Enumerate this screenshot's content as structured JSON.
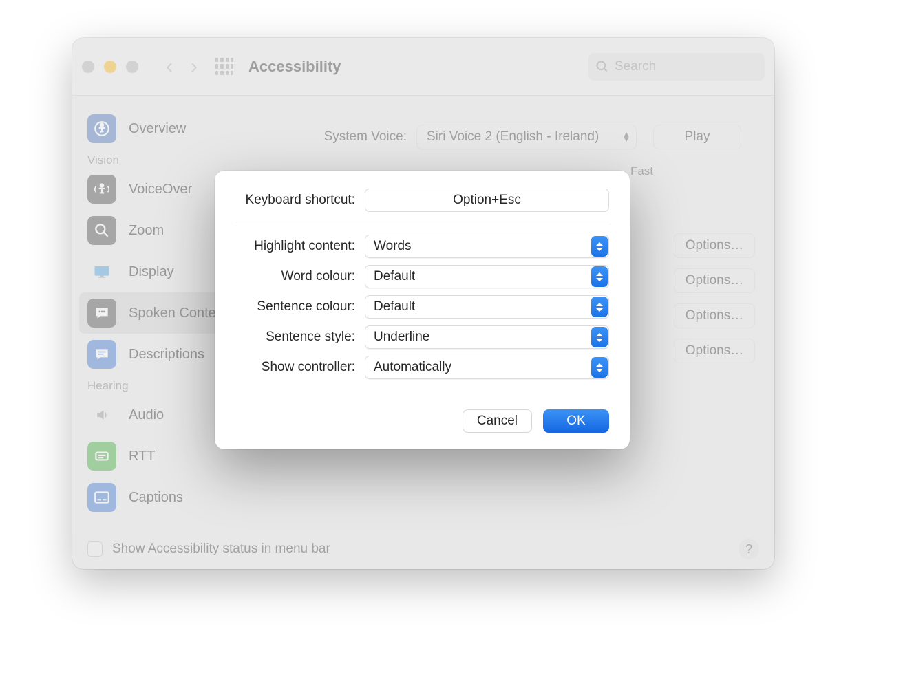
{
  "window": {
    "title": "Accessibility",
    "search_placeholder": "Search"
  },
  "sidebar": {
    "sections": {
      "vision_label": "Vision",
      "hearing_label": "Hearing"
    },
    "items": {
      "overview": "Overview",
      "voiceover": "VoiceOver",
      "zoom": "Zoom",
      "display": "Display",
      "spoken": "Spoken Content",
      "descriptions": "Descriptions",
      "audio": "Audio",
      "rtt": "RTT",
      "captions": "Captions"
    }
  },
  "main": {
    "system_voice_label": "System Voice:",
    "system_voice_value": "Siri Voice 2 (English - Ireland)",
    "play_button": "Play",
    "speed_fast": "Fast",
    "options_button": "Options…"
  },
  "footer": {
    "status_label": "Show Accessibility status in menu bar",
    "help": "?"
  },
  "sheet": {
    "keyboard_shortcut_label": "Keyboard shortcut:",
    "keyboard_shortcut_value": "Option+Esc",
    "highlight_label": "Highlight content:",
    "highlight_value": "Words",
    "word_colour_label": "Word colour:",
    "word_colour_value": "Default",
    "sentence_colour_label": "Sentence colour:",
    "sentence_colour_value": "Default",
    "sentence_style_label": "Sentence style:",
    "sentence_style_value": "Underline",
    "show_controller_label": "Show controller:",
    "show_controller_value": "Automatically",
    "cancel": "Cancel",
    "ok": "OK"
  }
}
